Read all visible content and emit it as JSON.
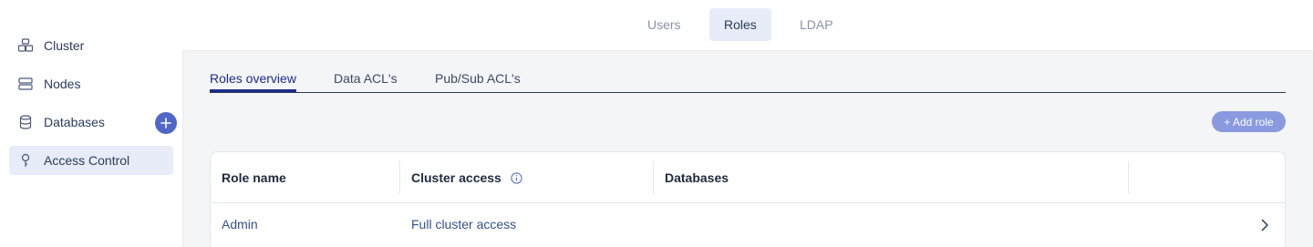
{
  "sidebar": {
    "items": [
      {
        "label": "Cluster",
        "icon": "cluster-icon"
      },
      {
        "label": "Nodes",
        "icon": "nodes-icon"
      },
      {
        "label": "Databases",
        "icon": "database-icon"
      },
      {
        "label": "Access Control",
        "icon": "key-icon"
      }
    ],
    "active": "Access Control"
  },
  "top_tabs": {
    "items": [
      "Users",
      "Roles",
      "LDAP"
    ],
    "active": "Roles"
  },
  "sub_tabs": {
    "items": [
      "Roles overview",
      "Data ACL's",
      "Pub/Sub ACL's"
    ],
    "active": "Roles overview"
  },
  "actions": {
    "add_role_label": "+ Add role"
  },
  "table": {
    "headers": [
      "Role name",
      "Cluster access",
      "Databases"
    ],
    "rows": [
      {
        "role_name": "Admin",
        "cluster_access": "Full cluster access",
        "databases": ""
      }
    ]
  },
  "colors": {
    "accent": "#5067c7",
    "active_bg": "#e7ecf8",
    "subtab_active": "#1d2b88",
    "button": "#8a9ae0"
  }
}
